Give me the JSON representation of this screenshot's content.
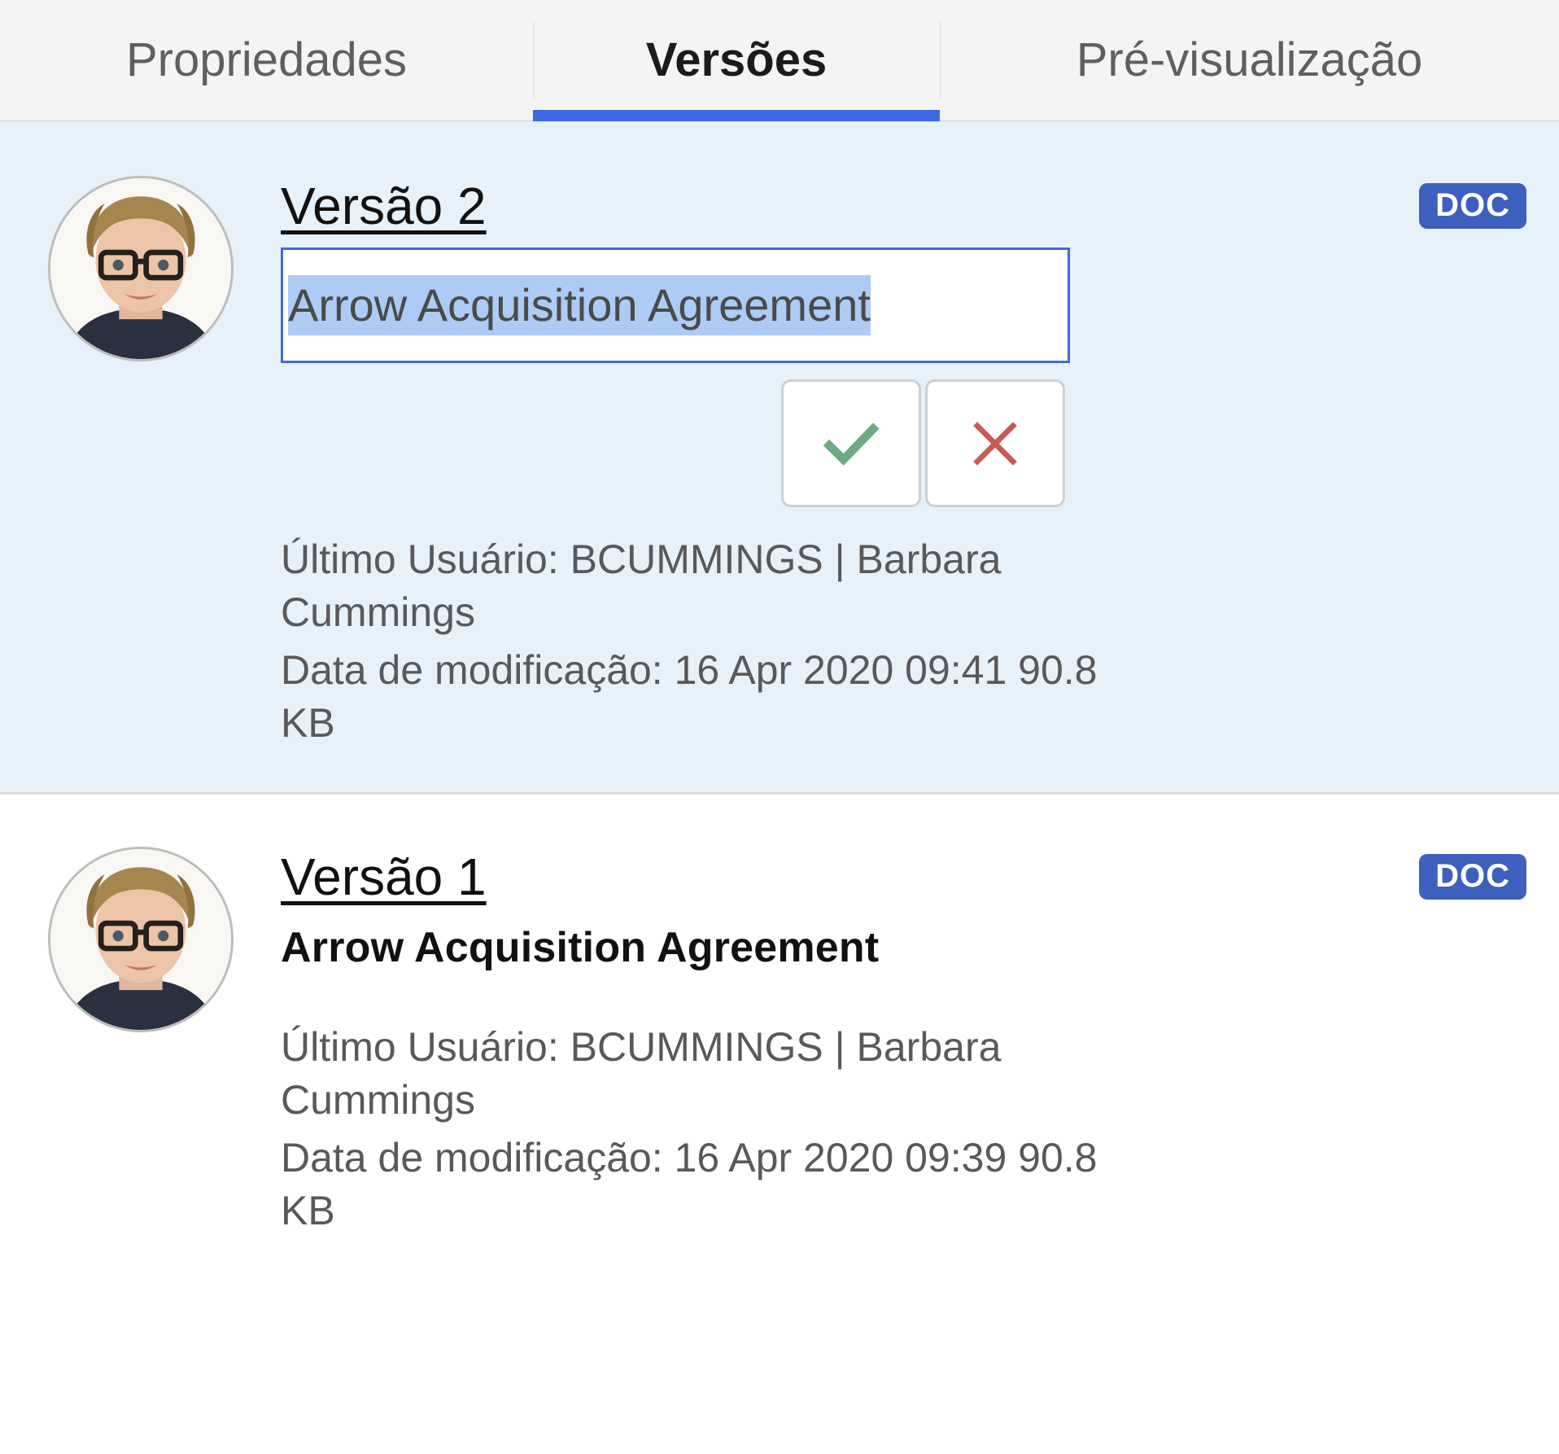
{
  "tabs": [
    {
      "label": "Propriedades",
      "active": false
    },
    {
      "label": "Versões",
      "active": true
    },
    {
      "label": "Pré-visualização",
      "active": false
    }
  ],
  "accent_color": "#4069e5",
  "selected_row_color": "#e6f1f9",
  "badge_color": "#3d5fbd",
  "check_color": "#6aab7f",
  "cross_color": "#c85a52",
  "versions": [
    {
      "version_label": "Versão 2",
      "badge": "DOC",
      "editing": true,
      "name_value": "Arrow Acquisition Agreement",
      "name_placeholder": "Arrow Acquisition Agreement",
      "confirm_icon": "check-icon",
      "cancel_icon": "cross-icon",
      "user_line": "Último Usuário: BCUMMINGS | Barbara Cummings",
      "modified_line": "Data de modificação: 16 Apr 2020 09:41  90.8 KB",
      "menu_icon": "kebab-menu-icon",
      "avatar_icon": "user-avatar-photo"
    },
    {
      "version_label": "Versão 1",
      "badge": "DOC",
      "editing": false,
      "name_value": "Arrow Acquisition Agreement",
      "user_line": "Último Usuário: BCUMMINGS | Barbara Cummings",
      "modified_line": "Data de modificação: 16 Apr 2020 09:39  90.8 KB",
      "menu_icon": "kebab-menu-icon",
      "avatar_icon": "user-avatar-photo"
    }
  ]
}
